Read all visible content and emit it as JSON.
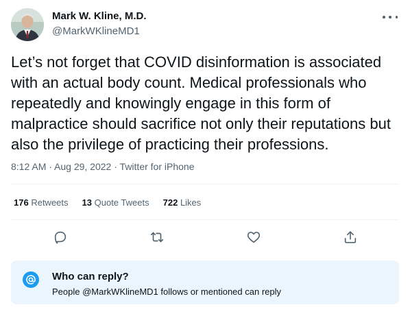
{
  "author": {
    "display_name": "Mark W. Kline, M.D.",
    "handle": "@MarkWKlineMD1",
    "avatar_icon": "profile-photo"
  },
  "more_icon": "more-horizontal-icon",
  "tweet": {
    "text": "Let’s not forget that COVID disinformation is associated with an actual body count. Medical professionals who repeatedly and knowingly engage in this form of malpractice should sacrifice not only their reputations but also the privilege of practicing their professions.",
    "time": "8:12 AM",
    "separator": " · ",
    "date": "Aug 29, 2022",
    "source": "Twitter for iPhone"
  },
  "stats": {
    "retweets_count": "176",
    "retweets_label": "Retweets",
    "quotes_count": "13",
    "quotes_label": "Quote Tweets",
    "likes_count": "722",
    "likes_label": "Likes"
  },
  "actions": [
    "reply-icon",
    "retweet-icon",
    "like-icon",
    "share-icon"
  ],
  "reply_restriction": {
    "title": "Who can reply?",
    "subtitle": "People @MarkWKlineMD1 follows or mentioned can reply",
    "icon": "at-mention-icon"
  },
  "colors": {
    "accent": "#1d9bf0",
    "text_primary": "#0f1419",
    "text_secondary": "#536471",
    "notice_bg": "#eaf5fd",
    "divider": "#eff3f4"
  }
}
